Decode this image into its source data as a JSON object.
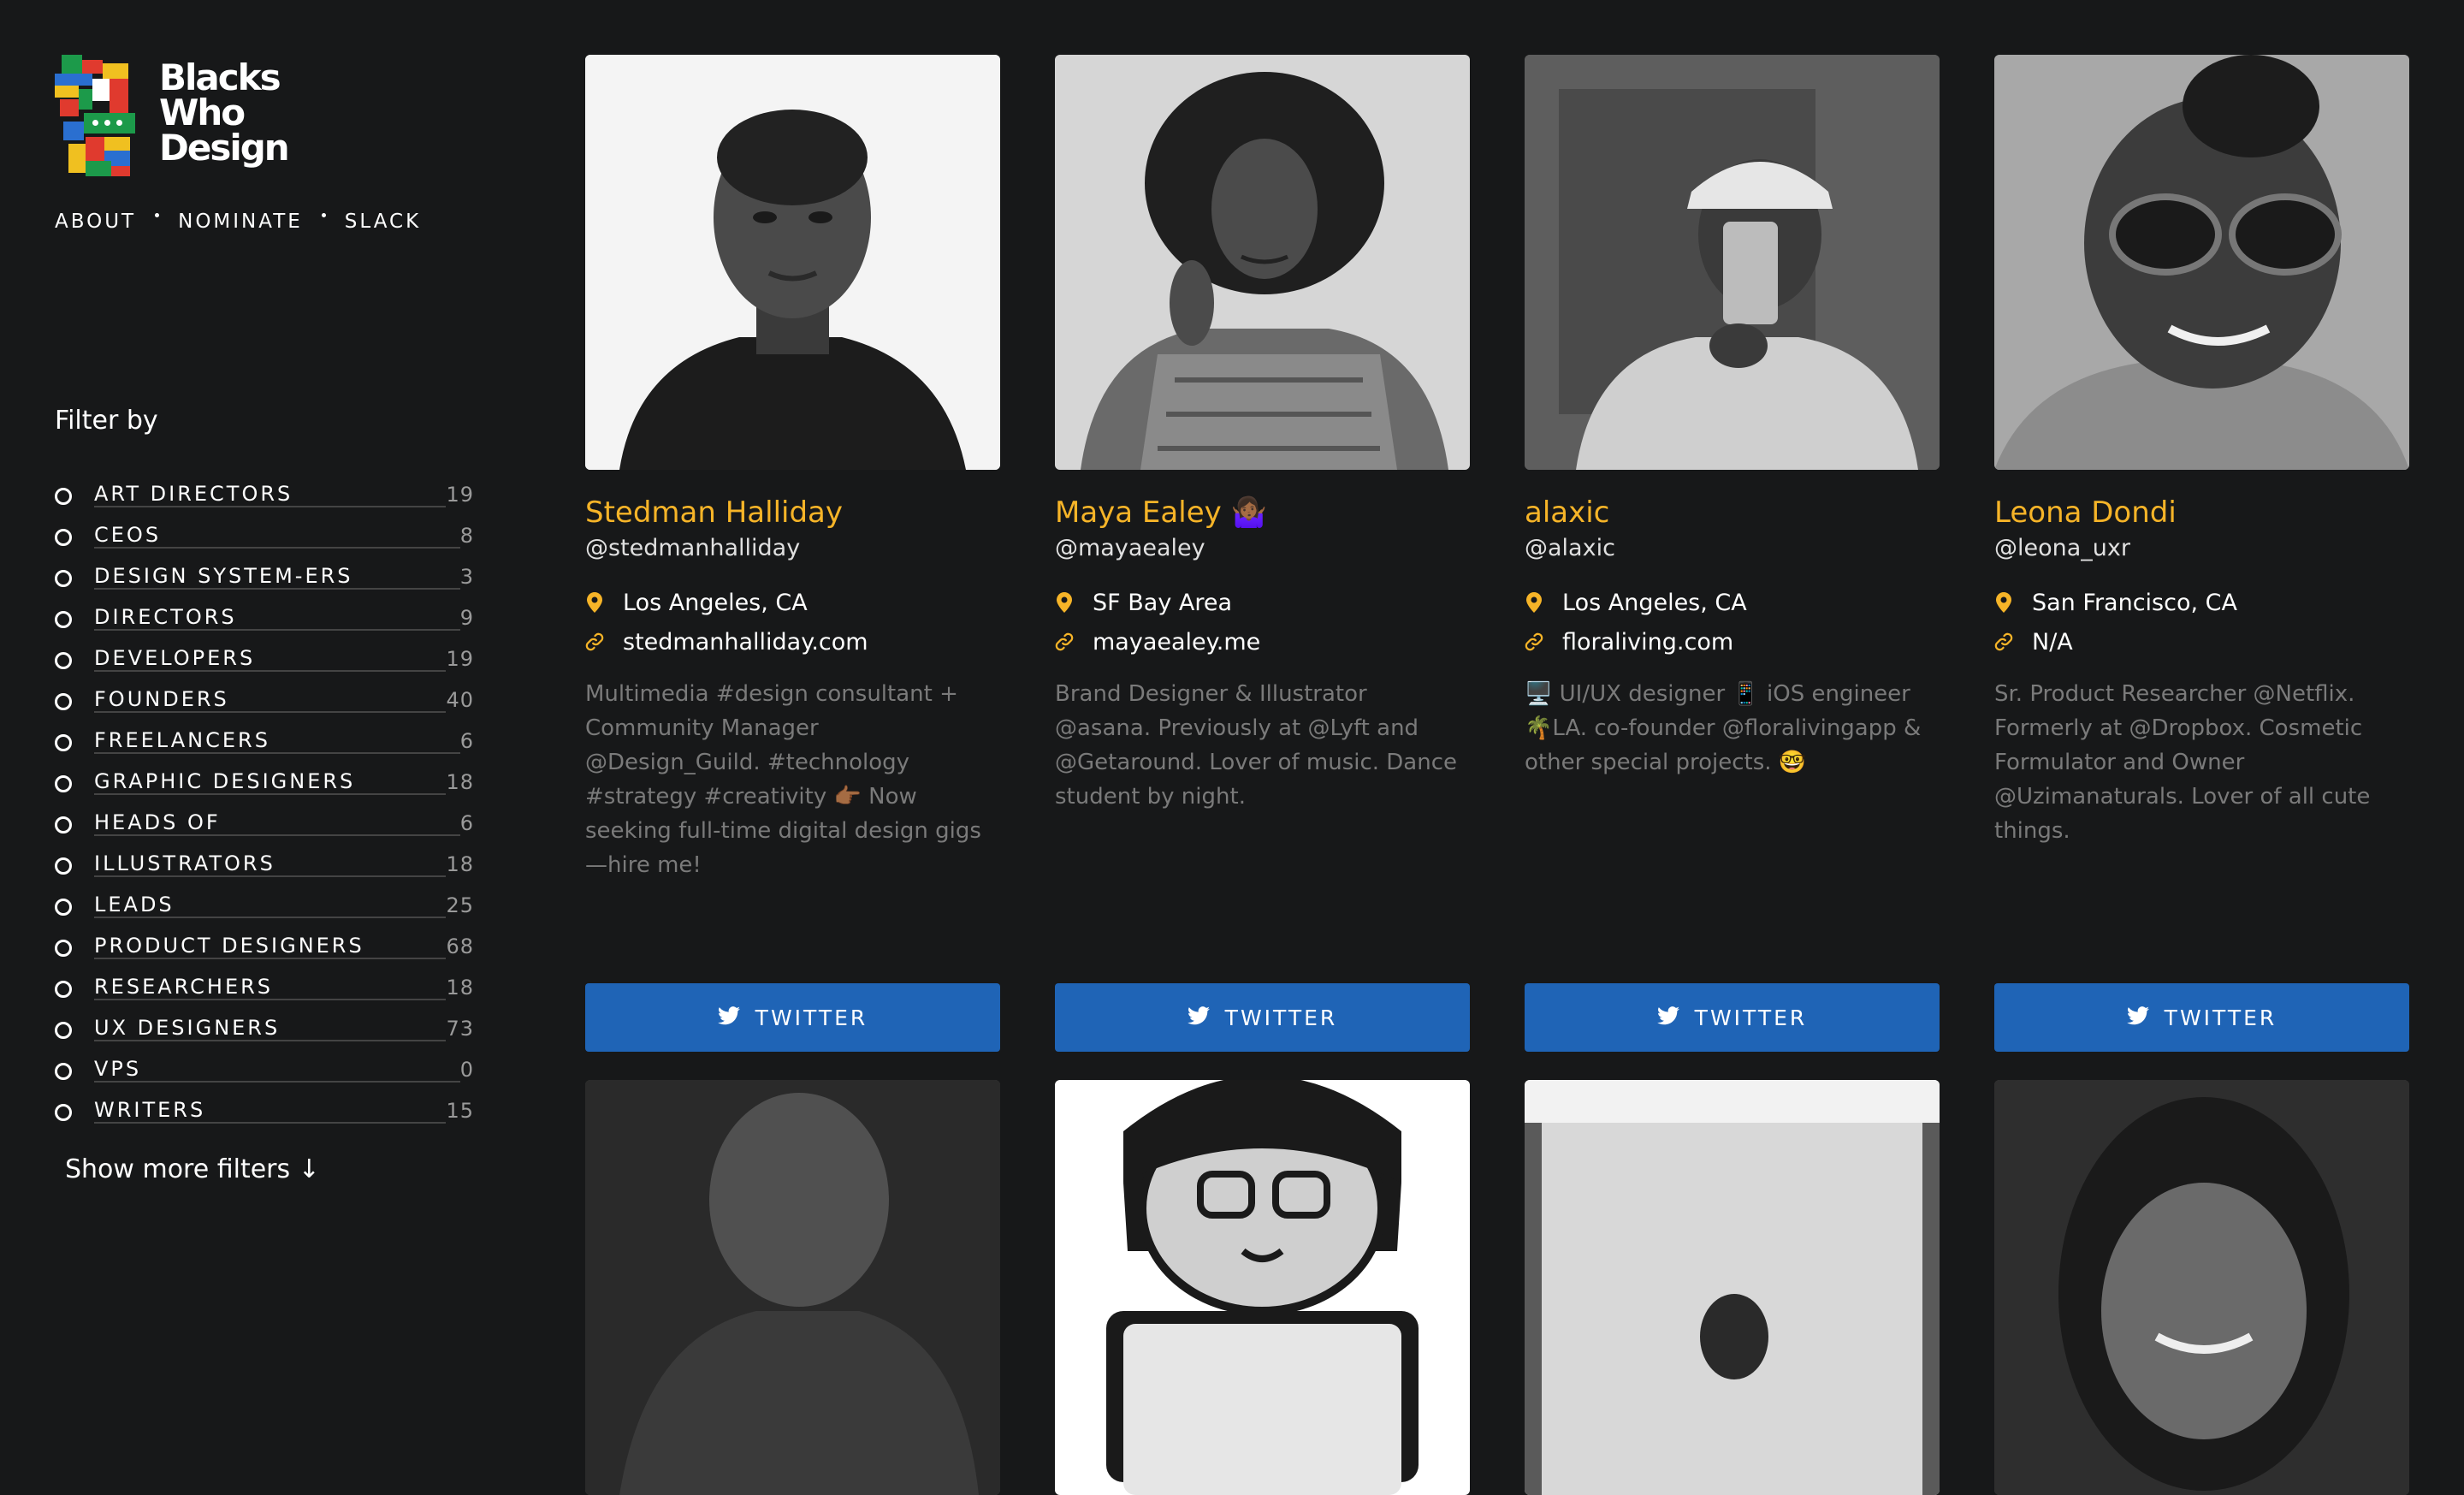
{
  "brand": {
    "logo_lines": [
      "Blacks",
      "Who",
      "Design"
    ]
  },
  "nav": {
    "items": [
      "ABOUT",
      "NOMINATE",
      "SLACK"
    ]
  },
  "filters": {
    "title": "Filter by",
    "items": [
      {
        "label": "ART DIRECTORS",
        "count": "19"
      },
      {
        "label": "CEOS",
        "count": "8"
      },
      {
        "label": "DESIGN SYSTEM-ERS",
        "count": "3"
      },
      {
        "label": "DIRECTORS",
        "count": "9"
      },
      {
        "label": "DEVELOPERS",
        "count": "19"
      },
      {
        "label": "FOUNDERS",
        "count": "40"
      },
      {
        "label": "FREELANCERS",
        "count": "6"
      },
      {
        "label": "GRAPHIC DESIGNERS",
        "count": "18"
      },
      {
        "label": "HEADS OF",
        "count": "6"
      },
      {
        "label": "ILLUSTRATORS",
        "count": "18"
      },
      {
        "label": "LEADS",
        "count": "25"
      },
      {
        "label": "PRODUCT DESIGNERS",
        "count": "68"
      },
      {
        "label": "RESEARCHERS",
        "count": "18"
      },
      {
        "label": "UX DESIGNERS",
        "count": "73"
      },
      {
        "label": "VPS",
        "count": "0"
      },
      {
        "label": "WRITERS",
        "count": "15"
      }
    ],
    "show_more": "Show more filters ↓"
  },
  "colors": {
    "background": "#171819",
    "accent": "#f6b428",
    "twitter_button": "#1f64b6"
  },
  "cards": [
    {
      "name": "Stedman Halliday",
      "handle": "@stedmanhalliday",
      "location": "Los Angeles, CA",
      "website": "stedmanhalliday.com",
      "bio": "Multimedia #design consultant + Community Manager @Design_Guild. #technology #strategy #creativity 👉🏾 Now seeking full-time digital design gigs —hire me!",
      "button": "TWITTER",
      "photo": "portrait-man-white-background"
    },
    {
      "name": "Maya Ealey 🤷🏾‍♀️",
      "handle": "@mayaealey",
      "location": "SF Bay Area",
      "website": "mayaealey.me",
      "bio": "Brand Designer & Illustrator @asana. Previously at @Lyft and @Getaround. Lover of music. Dance student by night.",
      "button": "TWITTER",
      "photo": "portrait-woman-curly-hair"
    },
    {
      "name": "alaxic",
      "handle": "@alaxic",
      "location": "Los Angeles, CA",
      "website": "floraliving.com",
      "bio": "🖥️ UI/UX designer 📱 iOS engineer 🌴LA. co-founder @floralivingapp & other special projects. 🤓",
      "button": "TWITTER",
      "photo": "mirror-selfie-cap"
    },
    {
      "name": "Leona Dondi",
      "handle": "@leona_uxr",
      "location": "San Francisco, CA",
      "website": "N/A",
      "bio": "Sr. Product Researcher @Netflix. Formerly at @Dropbox. Cosmetic Formulator and Owner @Uzimanaturals. Lover of all cute things.",
      "button": "TWITTER",
      "photo": "selfie-woman-sunglasses"
    }
  ]
}
